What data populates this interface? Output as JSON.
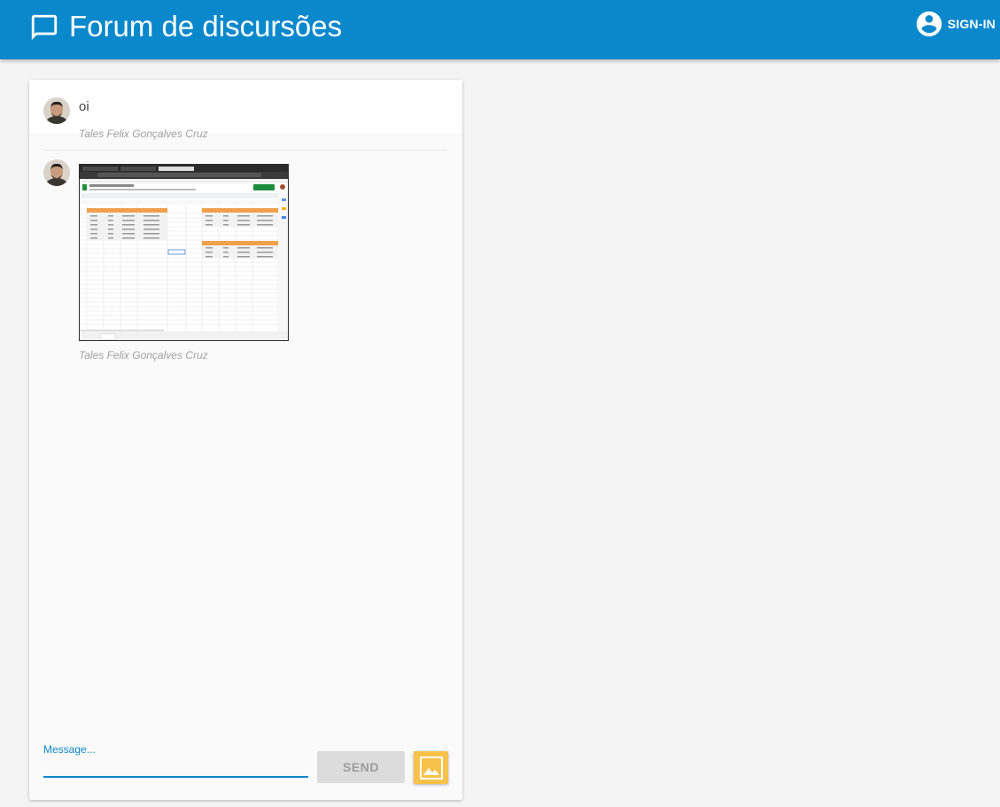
{
  "header": {
    "title": "Forum de discursões",
    "signin_label": "SIGN-IN",
    "title_icon": "chat-bubble-icon",
    "account_icon": "account-circle-icon",
    "color": "#0a88cc"
  },
  "messages": [
    {
      "text": "oi",
      "author": "Tales Felix Gonçalves Cruz"
    },
    {
      "image": "spreadsheet-screenshot",
      "author": "Tales Felix Gonçalves Cruz"
    }
  ],
  "compose": {
    "placeholder": "Message...",
    "send_label": "SEND",
    "image_icon": "image-icon",
    "image_button_color": "#f6c24a"
  }
}
